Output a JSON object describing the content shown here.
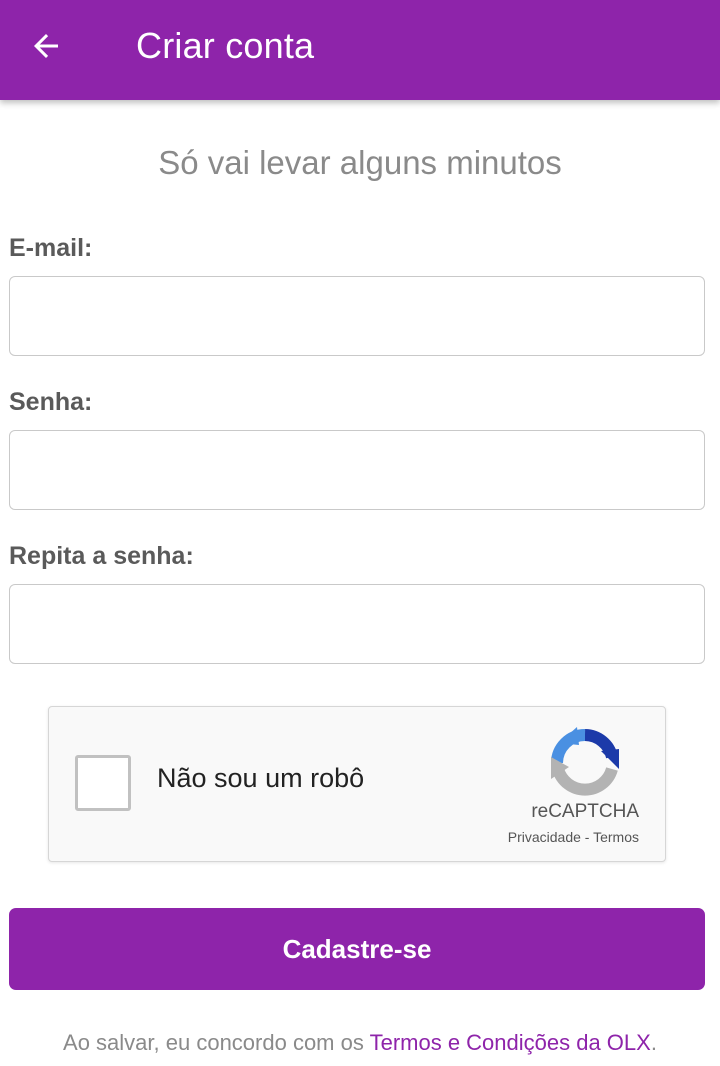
{
  "header": {
    "title": "Criar conta",
    "back_icon": "arrow-left-icon",
    "background": "#8e24aa"
  },
  "subtitle": "Só vai levar alguns minutos",
  "form": {
    "email": {
      "label": "E-mail:",
      "value": "",
      "placeholder": ""
    },
    "password": {
      "label": "Senha:",
      "value": "",
      "placeholder": ""
    },
    "repeat_password": {
      "label": "Repita a senha:",
      "value": "",
      "placeholder": ""
    }
  },
  "captcha": {
    "label": "Não sou um robô",
    "brand": "reCAPTCHA",
    "privacy": "Privacidade",
    "separator": " - ",
    "terms": "Termos",
    "checked": false
  },
  "submit": {
    "label": "Cadastre-se"
  },
  "footer": {
    "prefix": "Ao salvar, eu concordo com os ",
    "link": "Termos e Condições da OLX",
    "suffix": "."
  },
  "colors": {
    "accent": "#8e24aa",
    "label_text": "#5a5a5a",
    "muted_text": "#8a8a8a",
    "recaptcha_blue": "#1c3aa9",
    "recaptcha_light_blue": "#4a90e2",
    "recaptcha_gray": "#b3b3b3"
  }
}
